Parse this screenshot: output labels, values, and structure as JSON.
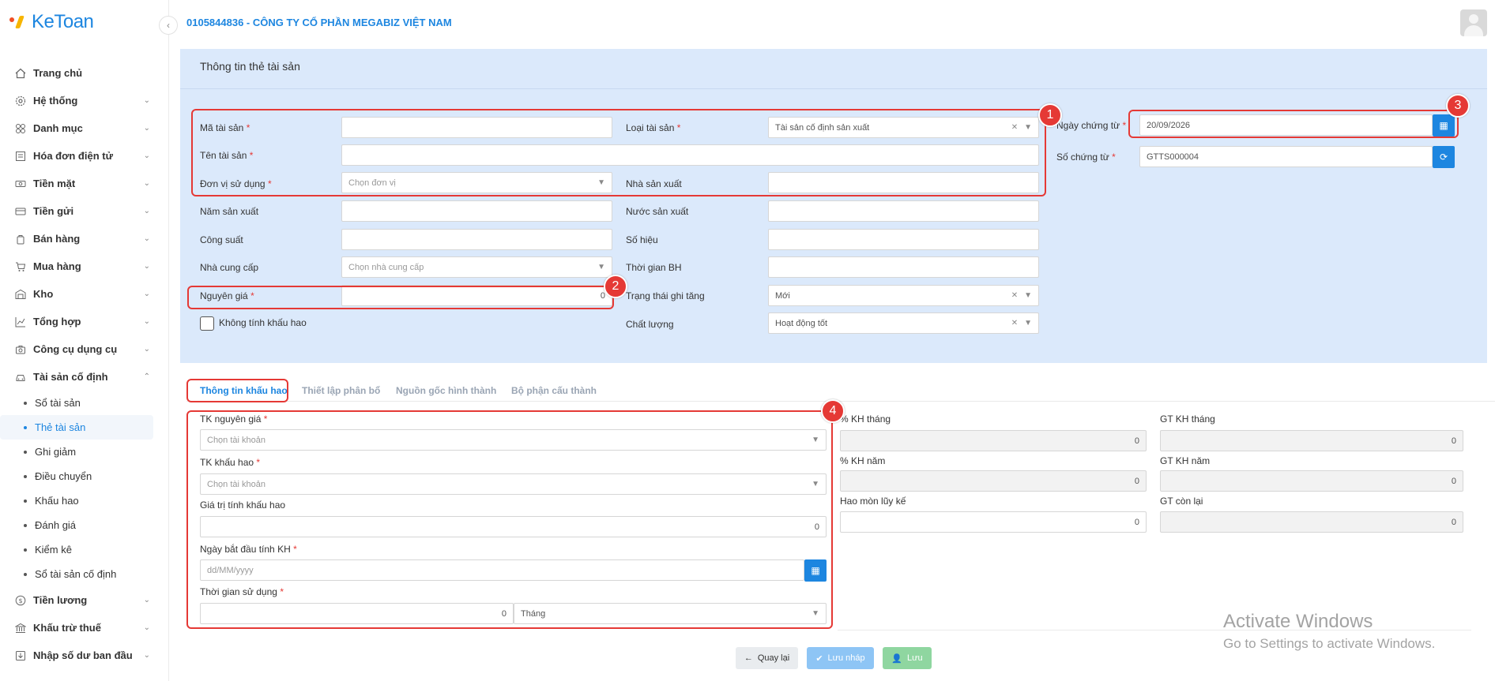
{
  "app": {
    "logo_text": "KeToan",
    "company": "0105844836 - CÔNG TY CỔ PHẦN MEGABIZ VIỆT NAM"
  },
  "sidebar": {
    "items": [
      {
        "label": "Trang chủ",
        "icon": "home-icon"
      },
      {
        "label": "Hệ thống",
        "icon": "gear-icon"
      },
      {
        "label": "Danh mục",
        "icon": "grid-icon"
      },
      {
        "label": "Hóa đơn điện tử",
        "icon": "invoice-icon"
      },
      {
        "label": "Tiền mặt",
        "icon": "cash-icon"
      },
      {
        "label": "Tiền gửi",
        "icon": "card-icon"
      },
      {
        "label": "Bán hàng",
        "icon": "bag-icon"
      },
      {
        "label": "Mua hàng",
        "icon": "cart-icon"
      },
      {
        "label": "Kho",
        "icon": "warehouse-icon"
      },
      {
        "label": "Tổng hợp",
        "icon": "chart-icon"
      },
      {
        "label": "Công cụ dụng cụ",
        "icon": "tools-icon"
      },
      {
        "label": "Tài sản cố định",
        "icon": "car-icon"
      }
    ],
    "subitems": [
      "Sổ tài sản",
      "Thẻ tài sản",
      "Ghi giảm",
      "Điều chuyển",
      "Khấu hao",
      "Đánh giá",
      "Kiểm kê",
      "Sổ tài sản cố định"
    ],
    "bottom_items": [
      {
        "label": "Tiền lương",
        "icon": "dollar-icon"
      },
      {
        "label": "Khấu trừ thuế",
        "icon": "bank-icon"
      },
      {
        "label": "Nhập số dư ban đầu",
        "icon": "import-icon"
      }
    ]
  },
  "form": {
    "title": "Thông tin thẻ tài sản",
    "ma_tai_san": {
      "label": "Mã tài sản",
      "value": ""
    },
    "ten_tai_san": {
      "label": "Tên tài sản",
      "value": ""
    },
    "don_vi": {
      "label": "Đơn vị sử dụng",
      "placeholder": "Chọn đơn vị"
    },
    "nam_sx": {
      "label": "Năm sản xuất"
    },
    "cong_suat": {
      "label": "Công suất"
    },
    "nha_cc": {
      "label": "Nhà cung cấp",
      "placeholder": "Chọn nhà cung cấp"
    },
    "nguyen_gia": {
      "label": "Nguyên giá",
      "value": "0"
    },
    "khong_kh": {
      "label": "Không tính khấu hao"
    },
    "loai_ts": {
      "label": "Loại tài sản",
      "value": "Tài sản cố định sản xuất"
    },
    "nha_sx": {
      "label": "Nhà sản xuất"
    },
    "nuoc_sx": {
      "label": "Nước sản xuất"
    },
    "so_hieu": {
      "label": "Số hiệu"
    },
    "tg_bh": {
      "label": "Thời gian BH"
    },
    "trang_thai": {
      "label": "Trạng thái ghi tăng",
      "value": "Mới"
    },
    "chat_luong": {
      "label": "Chất lượng",
      "value": "Hoạt động tốt"
    },
    "ngay_ct": {
      "label": "Ngày chứng từ",
      "value": "20/09/2026"
    },
    "so_ct": {
      "label": "Số chứng từ",
      "value": "GTTS000004"
    }
  },
  "tabs": [
    "Thông tin khấu hao",
    "Thiết lập phân bổ",
    "Nguồn gốc hình thành",
    "Bộ phận cấu thành"
  ],
  "depr": {
    "tk_ng": {
      "label": "TK nguyên giá",
      "placeholder": "Chọn tài khoản"
    },
    "tk_kh": {
      "label": "TK khấu hao",
      "placeholder": "Chọn tài khoản"
    },
    "gt_tinh": {
      "label": "Giá trị tính khấu hao",
      "value": "0"
    },
    "ngay_bd": {
      "label": "Ngày bắt đầu tính KH",
      "placeholder": "dd/MM/yyyy"
    },
    "tg_sd": {
      "label": "Thời gian sử dụng",
      "value": "0",
      "unit": "Tháng"
    },
    "kh_thang": {
      "label": "% KH tháng",
      "value": "0"
    },
    "gt_kh_thang": {
      "label": "GT KH tháng",
      "value": "0"
    },
    "kh_nam": {
      "label": "% KH năm",
      "value": "0"
    },
    "gt_kh_nam": {
      "label": "GT KH năm",
      "value": "0"
    },
    "hao_mon": {
      "label": "Hao mòn lũy kế",
      "value": "0"
    },
    "gt_con_lai": {
      "label": "GT còn lại",
      "value": "0"
    }
  },
  "actions": {
    "back": "Quay lại",
    "draft": "Lưu nháp",
    "save": "Lưu"
  },
  "annotations": [
    "1",
    "2",
    "3",
    "4"
  ],
  "watermark": {
    "line1": "Activate Windows",
    "line2": "Go to Settings to activate Windows."
  },
  "colors": {
    "accent": "#1d86e0",
    "annotation": "#e53935",
    "panel": "#dbe9fb"
  }
}
